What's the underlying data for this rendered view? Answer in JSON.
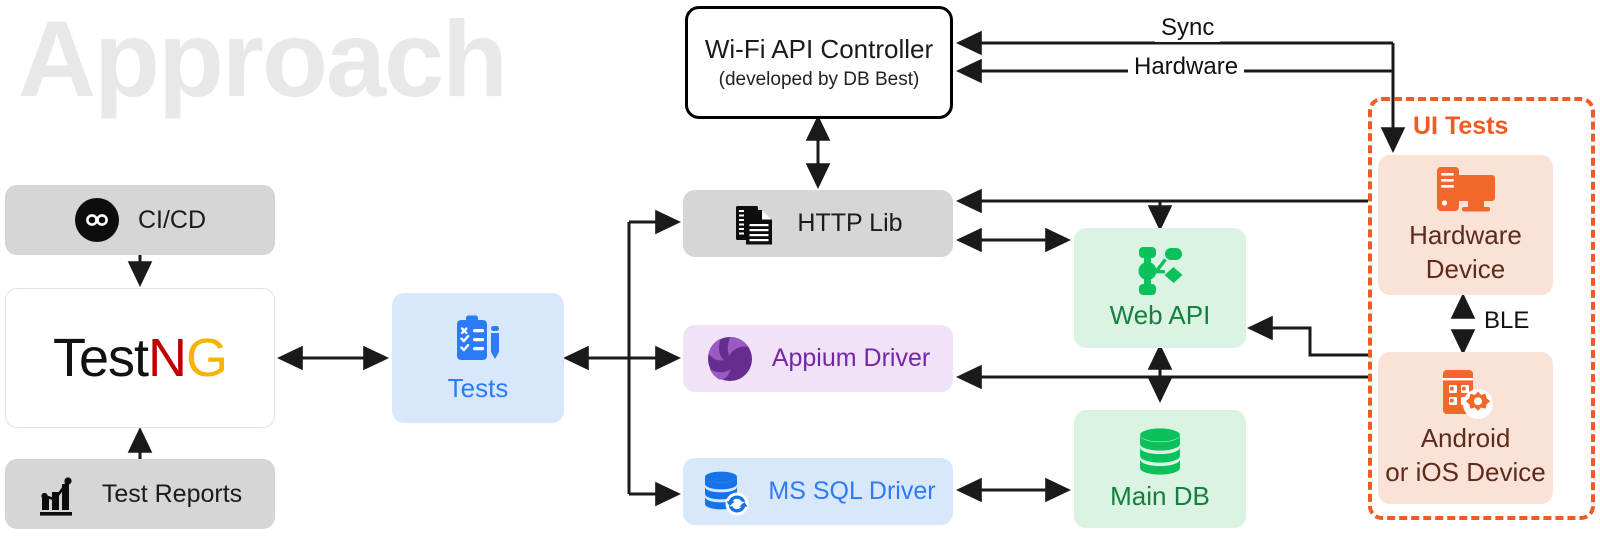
{
  "page": {
    "title": "Approach"
  },
  "colors": {
    "title_gray": "#e8e8e8",
    "gray_box": "#d6d6d6",
    "blue_box": "#d9e7fd",
    "blue_text": "#2b7cf6",
    "purple_box": "#f0e2f7",
    "purple_text": "#7526a8",
    "green_box": "#daf3e3",
    "green_text": "#15803d",
    "green_icon": "#0bc15c",
    "peach_box": "#fbe2d6",
    "orange": "#f15a22",
    "black": "#000000"
  },
  "nodes": {
    "cicd": {
      "label": "CI/CD",
      "icon": "infinity-icon"
    },
    "testng": {
      "part1": "Test",
      "part2": "N",
      "part3": "G",
      "full": "TestNG"
    },
    "test_reports": {
      "label": "Test Reports",
      "icon": "bar-chart-icon"
    },
    "tests": {
      "label": "Tests",
      "icon": "clipboard-checklist-icon"
    },
    "wifi_controller": {
      "label": "Wi-Fi API Controller",
      "sublabel": "(developed by DB Best)"
    },
    "http_lib": {
      "label": "HTTP Lib",
      "icon": "documents-icon"
    },
    "appium_driver": {
      "label": "Appium Driver",
      "icon": "appium-logo-icon"
    },
    "mssql_driver": {
      "label": "MS SQL Driver",
      "icon": "database-sync-icon"
    },
    "web_api": {
      "label": "Web API",
      "icon": "api-nodes-icon"
    },
    "main_db": {
      "label": "Main DB",
      "icon": "database-icon"
    },
    "hardware_device": {
      "line1": "Hardware",
      "line2": "Device",
      "icon": "desktop-computer-icon"
    },
    "android_ios_device": {
      "line1": "Android",
      "line2": "or iOS Device",
      "icon": "mobile-settings-icon"
    }
  },
  "groups": {
    "ui_tests": {
      "label": "UI Tests"
    }
  },
  "edge_labels": {
    "sync": "Sync",
    "hardware": "Hardware",
    "ble": "BLE"
  }
}
